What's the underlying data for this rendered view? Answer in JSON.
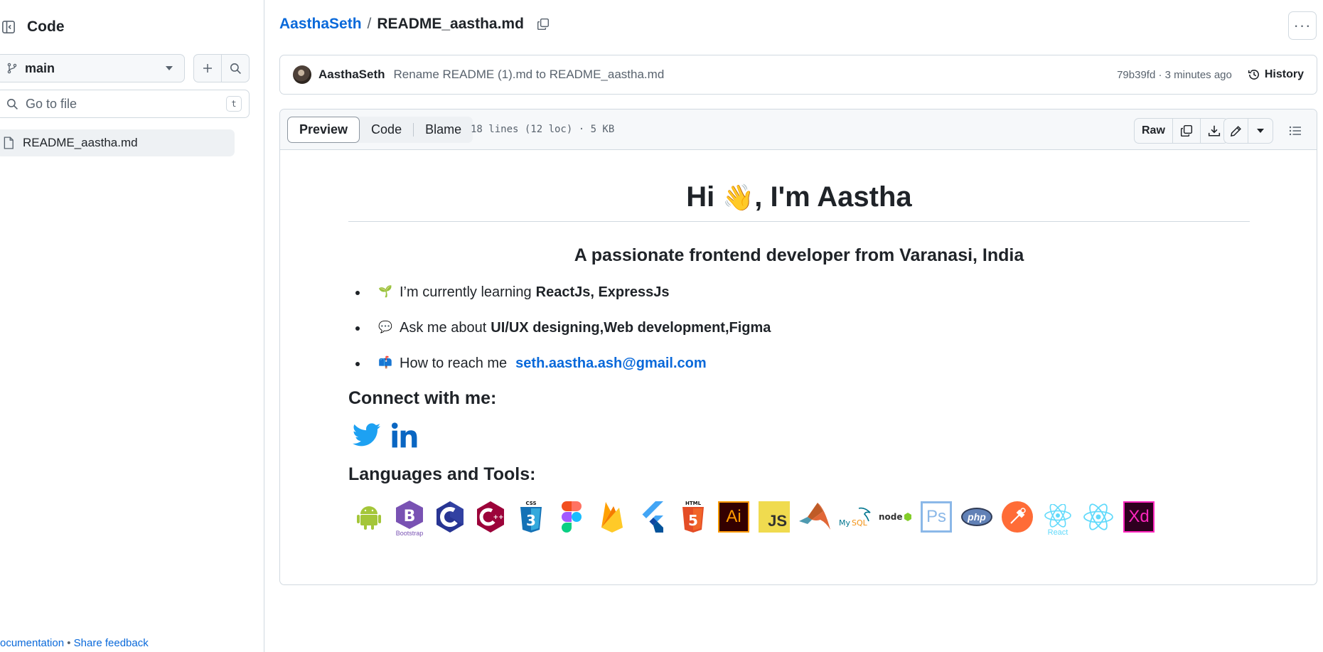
{
  "sidebar": {
    "title": "Code",
    "branch": "main",
    "search_placeholder": "Go to file",
    "shortcut_key": "t",
    "files": [
      {
        "name": "README_aastha.md"
      }
    ],
    "footer": {
      "docs": "ocumentation",
      "separator": "•",
      "feedback": "Share feedback"
    }
  },
  "header": {
    "owner": "AasthaSeth",
    "separator": "/",
    "filename": "README_aastha.md",
    "more_label": "···"
  },
  "commit": {
    "author": "AasthaSeth",
    "message": "Rename README (1).md to README_aastha.md",
    "meta": "79b39fd · 3 minutes ago",
    "history_label": "History"
  },
  "file": {
    "tabs": [
      "Preview",
      "Code",
      "Blame"
    ],
    "active_tab": "Preview",
    "info": "18 lines (12 loc) · 5 KB",
    "raw_label": "Raw"
  },
  "readme": {
    "title_pre": "Hi ",
    "wave": "👋",
    "title_post": ", I'm Aastha",
    "subtitle": "A passionate frontend developer from Varanasi, India",
    "items": [
      {
        "emoji": "🌱",
        "text": "I’m currently learning",
        "bold": "ReactJs, ExpressJs",
        "link": ""
      },
      {
        "emoji": "💬",
        "text": "Ask me about",
        "bold": "UI/UX designing,Web development,Figma",
        "link": ""
      },
      {
        "emoji": "📫",
        "text": "How to reach me",
        "bold": "",
        "link": "seth.aastha.ash@gmail.com"
      }
    ],
    "connect_heading": "Connect with me:",
    "social": [
      "twitter-icon",
      "linkedin-icon"
    ],
    "tools_heading": "Languages and Tools:",
    "tools": [
      {
        "name": "android",
        "label": ""
      },
      {
        "name": "bootstrap",
        "label": "Bootstrap"
      },
      {
        "name": "c",
        "label": "C"
      },
      {
        "name": "cplusplus",
        "label": "C++"
      },
      {
        "name": "css3",
        "label": "CSS"
      },
      {
        "name": "figma",
        "label": ""
      },
      {
        "name": "firebase",
        "label": ""
      },
      {
        "name": "flutter",
        "label": ""
      },
      {
        "name": "html5",
        "label": "HTML"
      },
      {
        "name": "illustrator",
        "label": "Ai"
      },
      {
        "name": "javascript",
        "label": "JS"
      },
      {
        "name": "matlab",
        "label": ""
      },
      {
        "name": "mysql",
        "label": "MySQL"
      },
      {
        "name": "nodejs",
        "label": "node"
      },
      {
        "name": "photoshop",
        "label": "Ps"
      },
      {
        "name": "php",
        "label": "php"
      },
      {
        "name": "postman",
        "label": ""
      },
      {
        "name": "react",
        "label": "React"
      },
      {
        "name": "reactnative",
        "label": ""
      },
      {
        "name": "xd",
        "label": "Xd"
      }
    ]
  },
  "colors": {
    "link": "#0969da",
    "border": "#d1d9e0",
    "muted": "#59636e"
  }
}
